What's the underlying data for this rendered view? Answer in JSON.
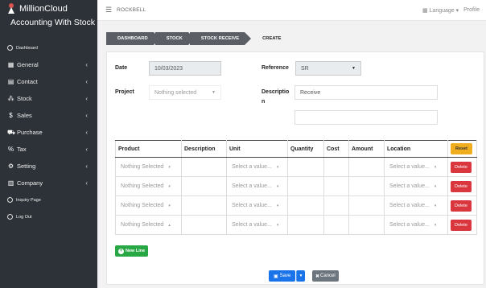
{
  "app": {
    "brand_name": "MillionCloud",
    "brand_sub": "Accounting With Stock"
  },
  "sidebar": {
    "items": [
      {
        "label": "Dashboard",
        "icon": "circle-icon",
        "small": true,
        "chevron": false
      },
      {
        "label": "General",
        "icon": "grid-icon",
        "small": false,
        "chevron": true
      },
      {
        "label": "Contact",
        "icon": "contact-card-icon",
        "small": false,
        "chevron": true
      },
      {
        "label": "Stock",
        "icon": "cubes-icon",
        "small": false,
        "chevron": true
      },
      {
        "label": "Sales",
        "icon": "dollar-icon",
        "small": false,
        "chevron": true
      },
      {
        "label": "Purchase",
        "icon": "cart-icon",
        "small": false,
        "chevron": true
      },
      {
        "label": "Tax",
        "icon": "percent-icon",
        "small": false,
        "chevron": true
      },
      {
        "label": "Setting",
        "icon": "gear-icon",
        "small": false,
        "chevron": true
      },
      {
        "label": "Company",
        "icon": "building-icon",
        "small": false,
        "chevron": true
      },
      {
        "label": "Inquiry Page",
        "icon": "circle-icon",
        "small": true,
        "chevron": false
      },
      {
        "label": "Log Out",
        "icon": "circle-icon",
        "small": true,
        "chevron": false
      }
    ]
  },
  "topbar": {
    "company": "ROCKBELL",
    "language": "Language",
    "profile": "Profile"
  },
  "breadcrumb": [
    "DASHBOARD",
    "STOCK",
    "STOCK RECEIVE",
    "CREATE"
  ],
  "form": {
    "date_label": "Date",
    "date_value": "10/03/2023",
    "reference_label": "Reference",
    "reference_value": "SR",
    "project_label": "Project",
    "project_value": "Nothing selected",
    "description_label_1": "Descriptio",
    "description_label_2": "n",
    "description_value": "Receive",
    "description_value_2": ""
  },
  "table": {
    "headers": [
      "Product",
      "Description",
      "Unit",
      "Quantity",
      "Cost",
      "Amount",
      "Location"
    ],
    "reset_label": "Reset",
    "rows": [
      {
        "product": "Nothing Selected",
        "unit": "Select a value...",
        "location": "Select a value...",
        "delete": "Delete",
        "product_caret": "▾"
      },
      {
        "product": "Nothing Selected",
        "unit": "Select a value...",
        "location": "Select a value...",
        "delete": "Delete",
        "product_caret": "▾"
      },
      {
        "product": "Nothing Selected",
        "unit": "Select a value...",
        "location": "Select a value...",
        "delete": "Delete",
        "product_caret": "▾"
      },
      {
        "product": "Nothing Selected",
        "unit": "Select a value...",
        "location": "Select a value...",
        "delete": "Delete",
        "product_caret": "▴"
      }
    ]
  },
  "buttons": {
    "new_line": "New Line",
    "save": "Save",
    "cancel": "Cancel"
  },
  "colors": {
    "sidebar_bg": "#2d3238",
    "save_blue": "#1a73e8",
    "delete_red": "#d9363e",
    "reset_yellow": "#f0ad1e",
    "new_green": "#28a745"
  }
}
